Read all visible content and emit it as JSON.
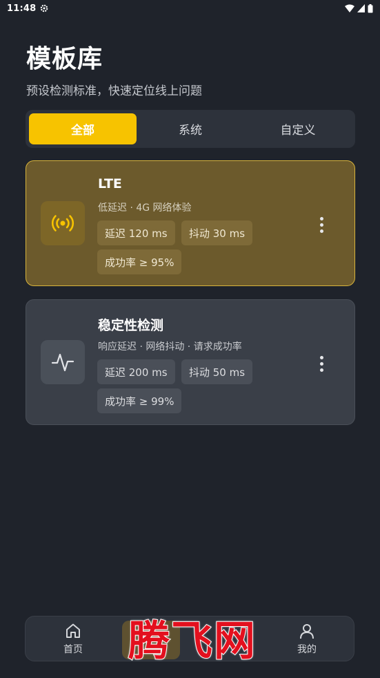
{
  "status_bar": {
    "time": "11:48"
  },
  "header": {
    "title": "模板库",
    "subtitle": "预设检测标准，快速定位线上问题"
  },
  "tabs": [
    {
      "label": "全部",
      "active": true
    },
    {
      "label": "系统",
      "active": false
    },
    {
      "label": "自定义",
      "active": false
    }
  ],
  "templates": [
    {
      "title": "LTE",
      "description": "低延迟 · 4G 网络体验",
      "icon": "broadcast-icon",
      "tags": [
        "延迟 120 ms",
        "抖动 30 ms",
        "成功率 ≥ 95%"
      ],
      "accent": "#f7c300"
    },
    {
      "title": "稳定性检测",
      "description": "响应延迟 · 网络抖动 · 请求成功率",
      "icon": "pulse-icon",
      "tags": [
        "延迟 200 ms",
        "抖动 50 ms",
        "成功率 ≥ 99%"
      ]
    }
  ],
  "bottom_nav": {
    "home": "首页",
    "me": "我的"
  },
  "watermark": "腾飞网",
  "colors": {
    "accent": "#f7c300",
    "background": "#1f232b",
    "surface": "#2d323b"
  }
}
